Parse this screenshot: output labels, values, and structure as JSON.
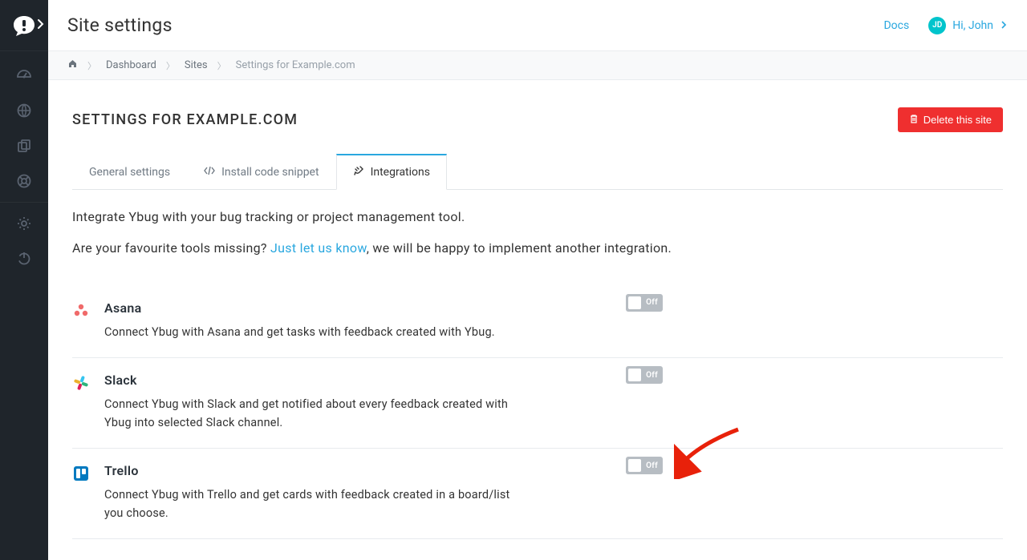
{
  "header": {
    "title": "Site settings",
    "docs": "Docs",
    "user_avatar": "JD",
    "user_greeting": "Hi, John"
  },
  "breadcrumb": {
    "dashboard": "Dashboard",
    "sites": "Sites",
    "current": "Settings for Example.com"
  },
  "card": {
    "title": "SETTINGS FOR EXAMPLE.COM",
    "delete_label": "Delete this site"
  },
  "tabs": {
    "general": "General settings",
    "install": "Install code snippet",
    "integrations": "Integrations"
  },
  "desc": {
    "line1": "Integrate Ybug with your bug tracking or project management tool.",
    "line2_a": "Are your favourite tools missing? ",
    "line2_link": "Just let us know",
    "line2_b": ", we will be happy to implement another integration."
  },
  "toggle_off": "Off",
  "integrations": [
    {
      "name": "Asana",
      "desc": "Connect Ybug with Asana and get tasks with feedback created with Ybug."
    },
    {
      "name": "Slack",
      "desc": "Connect Ybug with Slack and get notified about every feedback created with Ybug into selected Slack channel."
    },
    {
      "name": "Trello",
      "desc": "Connect Ybug with Trello and get cards with feedback created in a board/list you choose."
    }
  ]
}
